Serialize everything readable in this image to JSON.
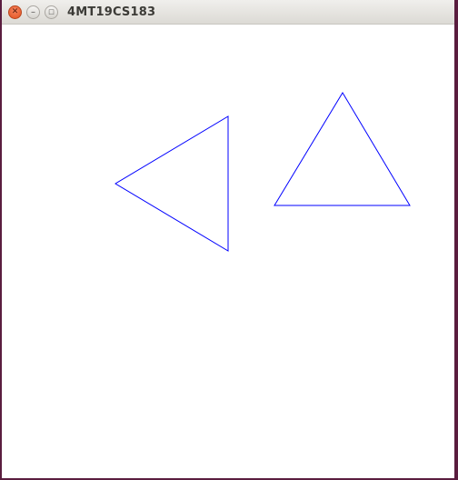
{
  "window": {
    "title": "4MT19CS183",
    "buttons": {
      "close_glyph": "✕",
      "minimize_glyph": "–",
      "maximize_glyph": "□"
    }
  },
  "drawing": {
    "stroke_color": "#0000ff",
    "background_color": "#ffffff",
    "shapes": [
      "triangle",
      "triangle"
    ]
  }
}
